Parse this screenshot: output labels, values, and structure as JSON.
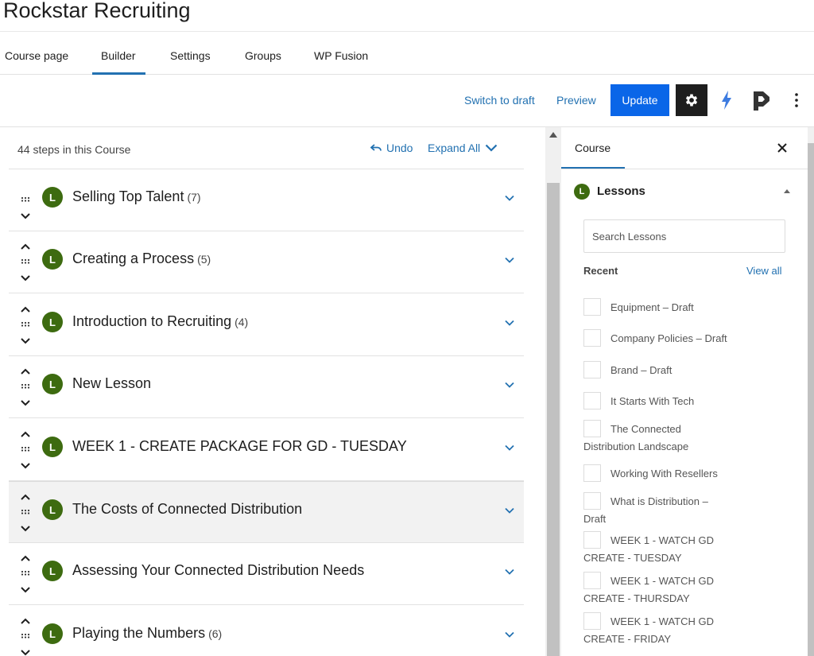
{
  "app": {
    "title": "Rockstar Recruiting"
  },
  "tabs": [
    {
      "label": "Course page"
    },
    {
      "label": "Builder"
    },
    {
      "label": "Settings"
    },
    {
      "label": "Groups"
    },
    {
      "label": "WP Fusion"
    }
  ],
  "toolbar": {
    "switch_draft": "Switch to draft",
    "preview": "Preview",
    "update": "Update",
    "brand_color": "#0a66e8"
  },
  "builder": {
    "steps_count": "44 steps in this Course",
    "undo": "Undo",
    "expand_all": "Expand All",
    "lessons": [
      {
        "badge": "L",
        "title": "Selling Top Talent",
        "count": "(7)"
      },
      {
        "badge": "L",
        "title": "Creating a Process",
        "count": "(5)"
      },
      {
        "badge": "L",
        "title": "Introduction to Recruiting",
        "count": "(4)"
      },
      {
        "badge": "L",
        "title": "New Lesson",
        "count": ""
      },
      {
        "badge": "L",
        "title": "WEEK 1 - CREATE PACKAGE FOR GD - TUESDAY",
        "count": ""
      },
      {
        "badge": "L",
        "title": "The Costs of Connected Distribution",
        "count": ""
      },
      {
        "badge": "L",
        "title": "Assessing Your Connected Distribution Needs",
        "count": ""
      },
      {
        "badge": "L",
        "title": "Playing the Numbers",
        "count": "(6)"
      }
    ]
  },
  "sidebar": {
    "tab": "Course",
    "section_badge": "L",
    "section_title": "Lessons",
    "search_placeholder": "Search Lessons",
    "recent_label": "Recent",
    "view_all": "View all",
    "items": [
      {
        "line1": "Equipment – Draft",
        "line2": ""
      },
      {
        "line1": "Company Policies – Draft",
        "line2": ""
      },
      {
        "line1": "Brand – Draft",
        "line2": ""
      },
      {
        "line1": "It Starts With Tech",
        "line2": ""
      },
      {
        "line1": "The Connected",
        "line2": "Distribution Landscape"
      },
      {
        "line1": "Working With Resellers",
        "line2": ""
      },
      {
        "line1": "What is Distribution –",
        "line2": "Draft"
      },
      {
        "line1": "WEEK 1 - WATCH GD",
        "line2": "CREATE - TUESDAY"
      },
      {
        "line1": "WEEK 1 - WATCH GD",
        "line2": "CREATE - THURSDAY"
      },
      {
        "line1": "WEEK 1 - WATCH GD",
        "line2": "CREATE - FRIDAY"
      }
    ]
  },
  "colors": {
    "accent": "#2271b1",
    "lesson_badge": "#3d6b10"
  }
}
